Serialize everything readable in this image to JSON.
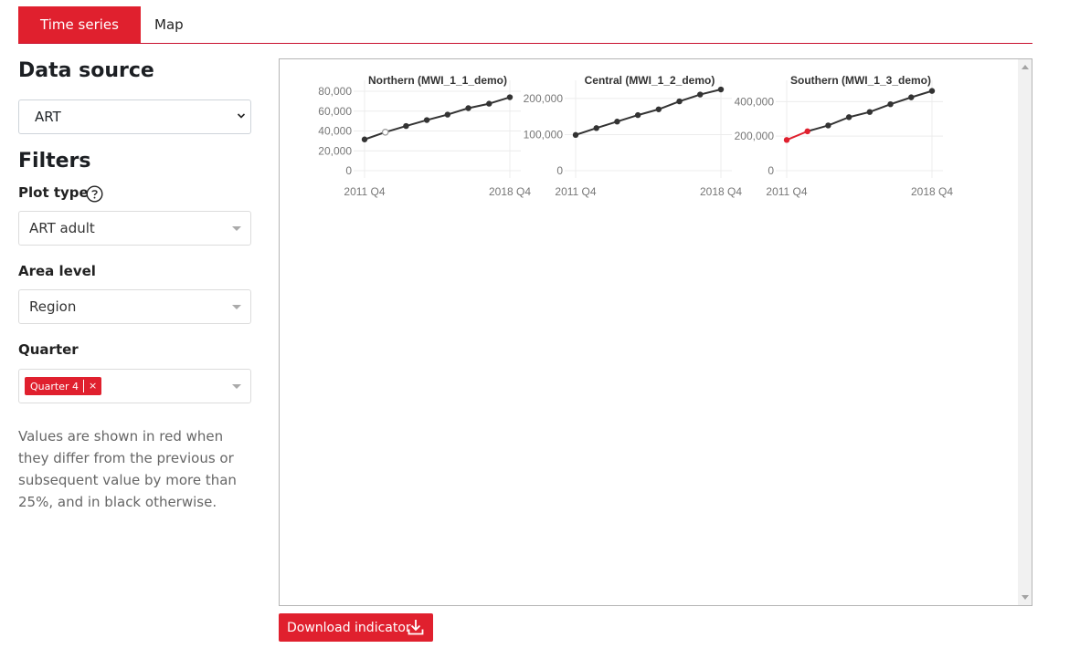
{
  "tabs": {
    "time_series": "Time series",
    "map": "Map"
  },
  "sidebar": {
    "data_source_heading": "Data source",
    "data_source_value": "ART",
    "filters_heading": "Filters",
    "plot_type_label": "Plot type",
    "plot_type_value": "ART adult",
    "area_level_label": "Area level",
    "area_level_value": "Region",
    "quarter_label": "Quarter",
    "quarter_chip": "Quarter 4",
    "quarter_chip_remove": "×",
    "help_text": "Values are shown in red when they differ from the previous or subsequent value by more than 25%, and in black otherwise."
  },
  "download_button": "Download indicator",
  "colors": {
    "accent": "#e0202e",
    "normal": "#333333",
    "flagged": "#e0202e"
  },
  "chart_data": [
    {
      "type": "line",
      "title": "Northern (MWI_1_1_demo)",
      "x_tick_labels": [
        "2011 Q4",
        "2018 Q4"
      ],
      "ylim": [
        0,
        80000
      ],
      "y_ticks": [
        "0",
        "20,000",
        "40,000",
        "60,000",
        "80,000"
      ],
      "y_tick_values": [
        0,
        20000,
        40000,
        60000,
        80000
      ],
      "x": [
        "2011 Q4",
        "2012 Q4",
        "2013 Q4",
        "2014 Q4",
        "2015 Q4",
        "2016 Q4",
        "2017 Q4",
        "2018 Q4"
      ],
      "values": [
        31500,
        38800,
        45000,
        51000,
        56500,
        63000,
        67500,
        74000
      ],
      "point_status": [
        "normal",
        "missing",
        "normal",
        "normal",
        "normal",
        "normal",
        "normal",
        "normal"
      ]
    },
    {
      "type": "line",
      "title": "Central (MWI_1_2_demo)",
      "x_tick_labels": [
        "2011 Q4",
        "2018 Q4"
      ],
      "ylim": [
        0,
        220000
      ],
      "y_ticks": [
        "0",
        "100,000",
        "200,000"
      ],
      "y_tick_values": [
        0,
        100000,
        200000
      ],
      "x": [
        "2011 Q4",
        "2012 Q4",
        "2013 Q4",
        "2014 Q4",
        "2015 Q4",
        "2016 Q4",
        "2017 Q4",
        "2018 Q4"
      ],
      "values": [
        99000,
        118000,
        136000,
        154000,
        170000,
        192000,
        211000,
        225000
      ],
      "point_status": [
        "normal",
        "normal",
        "normal",
        "normal",
        "normal",
        "normal",
        "normal",
        "normal"
      ]
    },
    {
      "type": "line",
      "title": "Southern (MWI_1_3_demo)",
      "x_tick_labels": [
        "2011 Q4",
        "2018 Q4"
      ],
      "ylim": [
        0,
        460000
      ],
      "y_ticks": [
        "0",
        "200,000",
        "400,000"
      ],
      "y_tick_values": [
        0,
        200000,
        400000
      ],
      "x": [
        "2011 Q4",
        "2012 Q4",
        "2013 Q4",
        "2014 Q4",
        "2015 Q4",
        "2016 Q4",
        "2017 Q4",
        "2018 Q4"
      ],
      "values": [
        178000,
        228000,
        262000,
        310000,
        340000,
        385000,
        425000,
        462000
      ],
      "point_status": [
        "flagged",
        "flagged",
        "normal",
        "normal",
        "normal",
        "normal",
        "normal",
        "normal"
      ]
    }
  ]
}
